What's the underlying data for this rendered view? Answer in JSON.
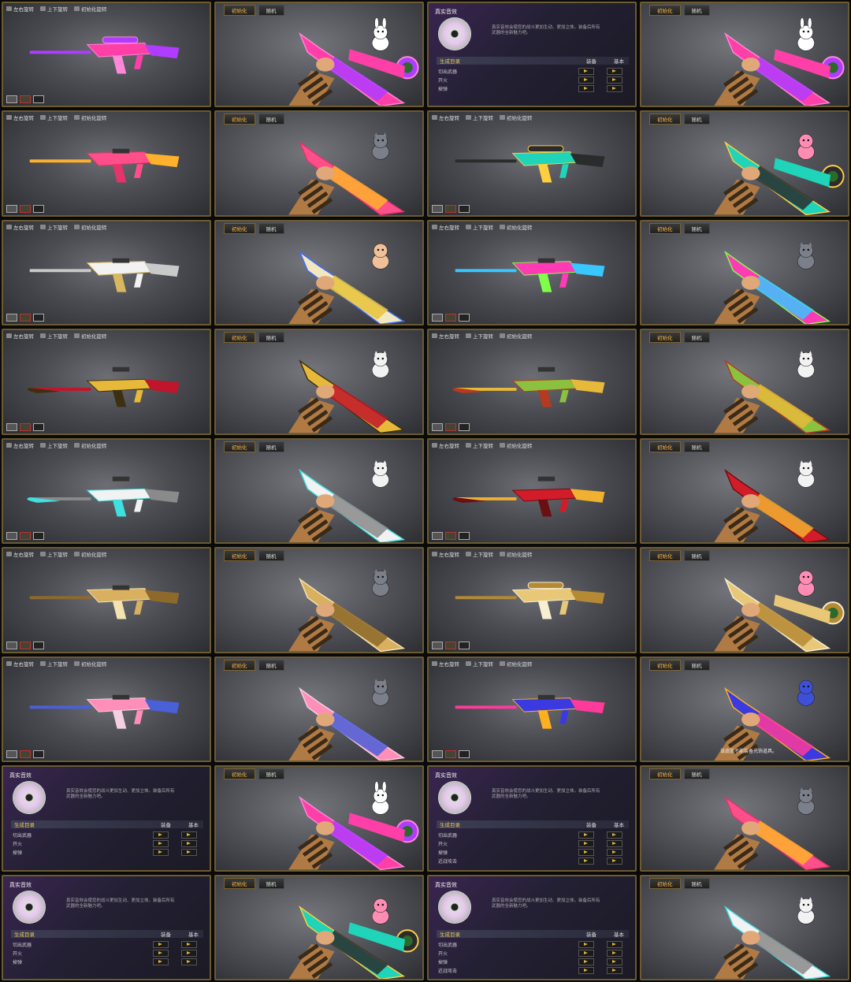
{
  "toolbar": {
    "rotate_lr": "左右旋转",
    "rotate_ud": "上下旋转",
    "reset": "初始化旋转"
  },
  "fp_bar": {
    "init": "初始化",
    "random": "随机"
  },
  "sound": {
    "title": "真实音效",
    "desc": "真实音效会使您的战斗更加生动、更加立体。装备后所有武器的全新魅力吧。",
    "header": "生成目录",
    "col_equip": "装备",
    "col_base": "基本",
    "rows_short": [
      "切出武器",
      "开火",
      "掉弹"
    ],
    "rows_long": [
      "切出武器",
      "开火",
      "掉弹",
      "近战攻击"
    ]
  },
  "skin_note": "该皮肤不能装备光饰道具。",
  "colors": {
    "frame": "#6b5a32",
    "accent": "#ffb640"
  },
  "panels": [
    {
      "type": "third",
      "skin": "pink-sniper"
    },
    {
      "type": "fp",
      "skin": "pink-sniper",
      "mascot": "rabbit"
    },
    {
      "type": "sound",
      "rows": "short"
    },
    {
      "type": "fp",
      "skin": "pink-sniper",
      "mascot": "rabbit"
    },
    {
      "type": "third",
      "skin": "pink-rifle"
    },
    {
      "type": "fp",
      "skin": "pink-rifle",
      "mascot": "cat"
    },
    {
      "type": "third",
      "skin": "teal-sniper"
    },
    {
      "type": "fp",
      "skin": "teal-sniper",
      "mascot": "doll"
    },
    {
      "type": "third",
      "skin": "white-rifle"
    },
    {
      "type": "fp",
      "skin": "gold-white-rifle",
      "mascot": "boy"
    },
    {
      "type": "third",
      "skin": "neon-rifle"
    },
    {
      "type": "fp",
      "skin": "neon-rifle",
      "mascot": "cat"
    },
    {
      "type": "third",
      "skin": "gold-red-ak"
    },
    {
      "type": "fp",
      "skin": "gold-red-ak",
      "mascot": "dog"
    },
    {
      "type": "third",
      "skin": "green-ak"
    },
    {
      "type": "fp",
      "skin": "green-ak",
      "mascot": "dog"
    },
    {
      "type": "third",
      "skin": "white-ak"
    },
    {
      "type": "fp",
      "skin": "white-ak",
      "mascot": "dog"
    },
    {
      "type": "third",
      "skin": "red-gold-ak"
    },
    {
      "type": "fp",
      "skin": "red-gold-ak",
      "mascot": "dog"
    },
    {
      "type": "third",
      "skin": "gold-rifle"
    },
    {
      "type": "fp",
      "skin": "gold-rifle",
      "mascot": "cat"
    },
    {
      "type": "third",
      "skin": "gold-sniper"
    },
    {
      "type": "fp",
      "skin": "gold-sniper",
      "mascot": "doll"
    },
    {
      "type": "third",
      "skin": "blue-pink-rifle"
    },
    {
      "type": "fp",
      "skin": "blue-pink-rifle",
      "mascot": "cat"
    },
    {
      "type": "third",
      "skin": "blue-neon-rifle"
    },
    {
      "type": "fp",
      "skin": "blue-neon-rifle",
      "mascot": "robot",
      "note": true
    },
    {
      "type": "sound",
      "rows": "short"
    },
    {
      "type": "fp",
      "skin": "pink-sniper",
      "mascot": "rabbit"
    },
    {
      "type": "sound",
      "rows": "long"
    },
    {
      "type": "fp",
      "skin": "pink-rifle",
      "mascot": "cat"
    },
    {
      "type": "sound",
      "rows": "short"
    },
    {
      "type": "fp",
      "skin": "teal-sniper",
      "mascot": "doll"
    },
    {
      "type": "sound",
      "rows": "long"
    },
    {
      "type": "fp",
      "skin": "white-ak",
      "mascot": "dog"
    }
  ]
}
